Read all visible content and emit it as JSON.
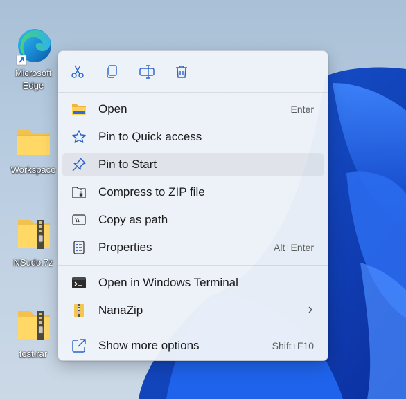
{
  "desktop": {
    "icons": [
      {
        "label_line1": "Microsoft",
        "label_line2": "Edge",
        "icon": "edge-icon"
      },
      {
        "label": "Workspace",
        "icon": "folder-icon"
      },
      {
        "label": "NSudo.7z",
        "icon": "zip-folder-icon"
      },
      {
        "label": "test.rar",
        "icon": "zip-folder-icon"
      }
    ]
  },
  "menu": {
    "toolbar": [
      {
        "name": "cut",
        "icon": "cut-icon"
      },
      {
        "name": "copy",
        "icon": "copy-icon"
      },
      {
        "name": "rename",
        "icon": "rename-icon"
      },
      {
        "name": "delete",
        "icon": "delete-icon"
      }
    ],
    "items": [
      {
        "label": "Open",
        "shortcut": "Enter",
        "icon": "folder-open-icon"
      },
      {
        "label": "Pin to Quick access",
        "shortcut": "",
        "icon": "star-icon"
      },
      {
        "label": "Pin to Start",
        "shortcut": "",
        "icon": "pin-icon"
      },
      {
        "label": "Compress to ZIP file",
        "shortcut": "",
        "icon": "zip-icon"
      },
      {
        "label": "Copy as path",
        "shortcut": "",
        "icon": "copy-path-icon"
      },
      {
        "label": "Properties",
        "shortcut": "Alt+Enter",
        "icon": "properties-icon"
      },
      {
        "label": "Open in Windows Terminal",
        "shortcut": "",
        "icon": "terminal-icon"
      },
      {
        "label": "NanaZip",
        "shortcut": "",
        "icon": "nanazip-icon"
      },
      {
        "label": "Show more options",
        "shortcut": "Shift+F10",
        "icon": "show-more-icon"
      }
    ]
  }
}
